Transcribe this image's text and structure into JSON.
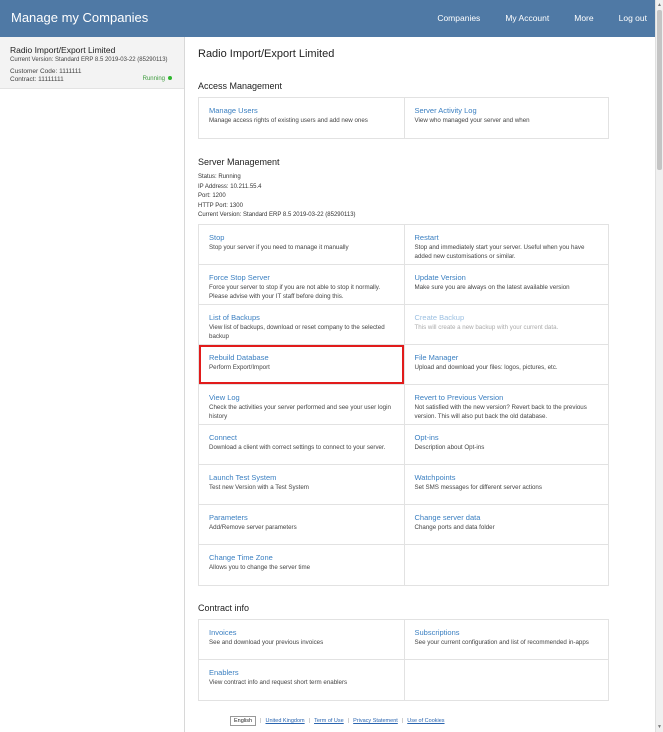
{
  "header": {
    "brand": "Manage my Companies",
    "nav": [
      "Companies",
      "My Account",
      "More",
      "Log out"
    ]
  },
  "sidebar": {
    "company_name": "Radio Import/Export Limited",
    "version": "Current Version: Standard ERP 8.5 2019-03-22 (85290113)",
    "customer_code": "Customer Code: 1111111",
    "contract": "Contract: 11111111",
    "status": "Running",
    "status_color": "#2fb72f"
  },
  "main": {
    "title": "Radio Import/Export Limited",
    "access_management": {
      "heading": "Access Management",
      "items": [
        {
          "label": "Manage Users",
          "desc": "Manage access rights of existing users and add new ones"
        },
        {
          "label": "Server Activity Log",
          "desc": "View who managed your server and when"
        }
      ]
    },
    "server_management": {
      "heading": "Server Management",
      "info": [
        "Status: Running",
        "IP Address: 10.211.55.4",
        "Port: 1200",
        "HTTP Port: 1300",
        "Current Version: Standard ERP 8.5 2019-03-22 (85290113)"
      ],
      "items": [
        {
          "label": "Stop",
          "desc": "Stop your server if you need to manage it manually"
        },
        {
          "label": "Restart",
          "desc": "Stop and immediately start your server. Useful when you have added new customisations or similar."
        },
        {
          "label": "Force Stop Server",
          "desc": "Force your server to stop if you are not able to stop it normally. Please advise with your IT staff before doing this."
        },
        {
          "label": "Update Version",
          "desc": "Make sure you are always on the latest available version"
        },
        {
          "label": "List of Backups",
          "desc": "View list of backups, download or reset company to the selected backup"
        },
        {
          "label": "Create Backup",
          "desc": "This will create a new backup with your current data."
        },
        {
          "label": "Rebuild Database",
          "desc": "Perform Export/Import"
        },
        {
          "label": "File Manager",
          "desc": "Upload and download your files: logos, pictures, etc."
        },
        {
          "label": "View Log",
          "desc": "Check the activities your server performed and see your user login history"
        },
        {
          "label": "Revert to Previous Version",
          "desc": "Not satisfied with the new version? Revert back to the previous version. This will also put back the old database."
        },
        {
          "label": "Connect",
          "desc": "Download a client with correct settings to connect to your server."
        },
        {
          "label": "Opt-ins",
          "desc": "Description about Opt-ins"
        },
        {
          "label": "Launch Test System",
          "desc": "Test new Version with a Test System"
        },
        {
          "label": "Watchpoints",
          "desc": "Set SMS messages for different server actions"
        },
        {
          "label": "Parameters",
          "desc": "Add/Remove server parameters"
        },
        {
          "label": "Change server data",
          "desc": "Change ports and data folder"
        },
        {
          "label": "Change Time Zone",
          "desc": "Allows you to change the server time"
        }
      ]
    },
    "contract_info": {
      "heading": "Contract info",
      "items": [
        {
          "label": "Invoices",
          "desc": "See and download your previous invoices"
        },
        {
          "label": "Subscriptions",
          "desc": "See your current configuration and list of recommended in-apps"
        },
        {
          "label": "Enablers",
          "desc": "View contract info and request short term enablers"
        }
      ]
    }
  },
  "footer": {
    "language": "English",
    "links": [
      "United Kingdom",
      "Term of Use",
      "Privacy Statement",
      "Use of Cookies"
    ]
  },
  "colors": {
    "header_bg": "#4f79a5",
    "link": "#3a7fc1",
    "highlight": "#e11b1b"
  }
}
